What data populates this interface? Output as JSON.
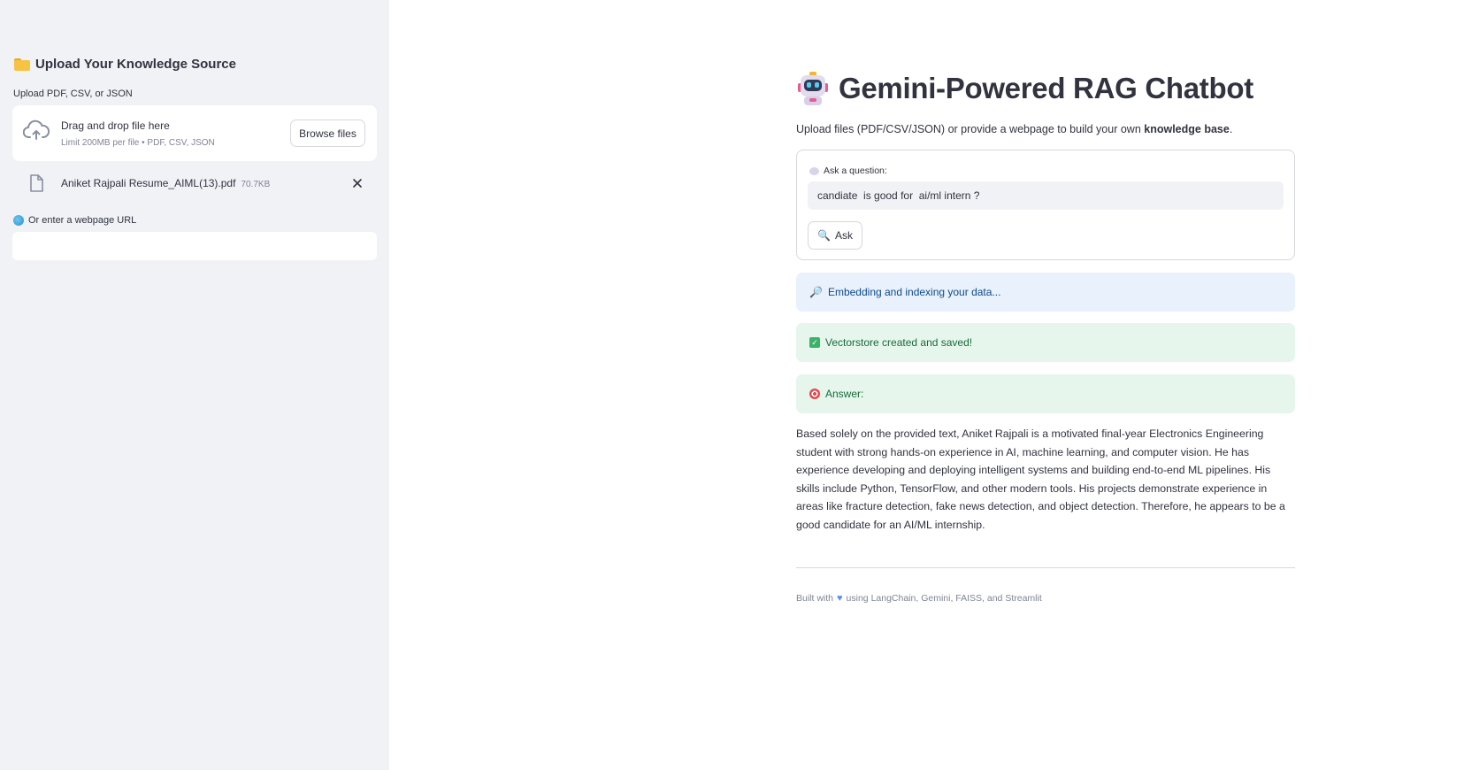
{
  "sidebar": {
    "header": "Upload Your Knowledge Source",
    "upload_label": "Upload PDF, CSV, or JSON",
    "dropzone": {
      "title": "Drag and drop file here",
      "subtitle": "Limit 200MB per file • PDF, CSV, JSON",
      "browse_label": "Browse files"
    },
    "file": {
      "name": "Aniket Rajpali Resume_AIML(13).pdf",
      "size": "70.7KB"
    },
    "url_label": "Or enter a webpage URL",
    "url_value": ""
  },
  "main": {
    "title": "Gemini-Powered RAG Chatbot",
    "intro_prefix": "Upload files (PDF/CSV/JSON) or provide a webpage to build your own ",
    "intro_bold": "knowledge base",
    "intro_suffix": ".",
    "ask_label": "Ask a question:",
    "question_value": "candiate  is good for  ai/ml intern ?",
    "ask_button": "Ask",
    "info_message": "Embedding and indexing your data...",
    "success_message": "Vectorstore created and saved!",
    "answer_label": "Answer:",
    "answer_text": "Based solely on the provided text, Aniket Rajpali is a motivated final-year Electronics Engineering student with strong hands-on experience in AI, machine learning, and computer vision. He has experience developing and deploying intelligent systems and building end-to-end ML pipelines. His skills include Python, TensorFlow, and other modern tools. His projects demonstrate experience in areas like fracture detection, fake news detection, and object detection. Therefore, he appears to be a good candidate for an AI/ML internship.",
    "footer_prefix": "Built with",
    "footer_suffix": "using LangChain, Gemini, FAISS, and Streamlit"
  },
  "icons": {
    "sidebar_header": "folder-icon",
    "dropzone": "cloud-upload-icon",
    "file": "file-icon",
    "remove": "close-icon",
    "url": "globe-icon",
    "title": "robot-icon",
    "ask_label": "speech-bubble-icon",
    "ask_button": "magnifier-icon",
    "info": "magnifier-icon",
    "success": "check-icon",
    "answer": "target-icon",
    "footer": "heart-icon"
  },
  "colors": {
    "sidebar_bg": "#f0f2f6",
    "info_bg": "#e8f1fc",
    "info_text": "#0e4a8a",
    "success_bg": "#e6f6ec",
    "success_text": "#176b3a"
  }
}
